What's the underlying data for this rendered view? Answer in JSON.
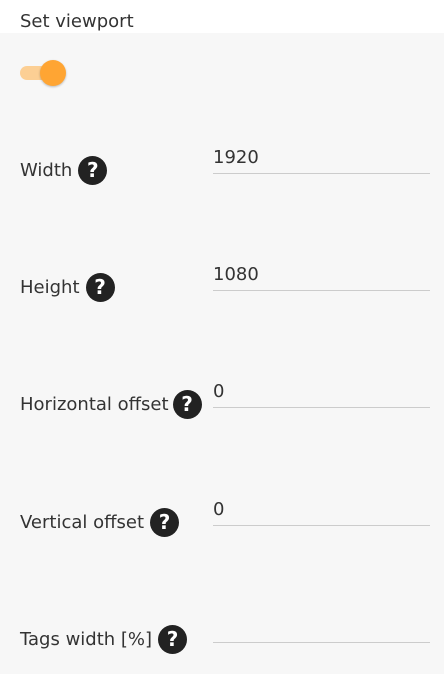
{
  "header": {
    "title": "Set viewport"
  },
  "toggle": {
    "state": "on",
    "accent_color": "#ffa533",
    "track_color": "#fccf94"
  },
  "fields": [
    {
      "label": "Width",
      "value": "1920",
      "help_icon": "question-circle-icon"
    },
    {
      "label": "Height",
      "value": "1080",
      "help_icon": "question-circle-icon"
    },
    {
      "label": "Horizontal offset",
      "value": "0",
      "help_icon": "question-circle-icon"
    },
    {
      "label": "Vertical offset",
      "value": "0",
      "help_icon": "question-circle-icon"
    },
    {
      "label": "Tags width [%]",
      "value": "",
      "help_icon": "question-circle-icon"
    }
  ]
}
